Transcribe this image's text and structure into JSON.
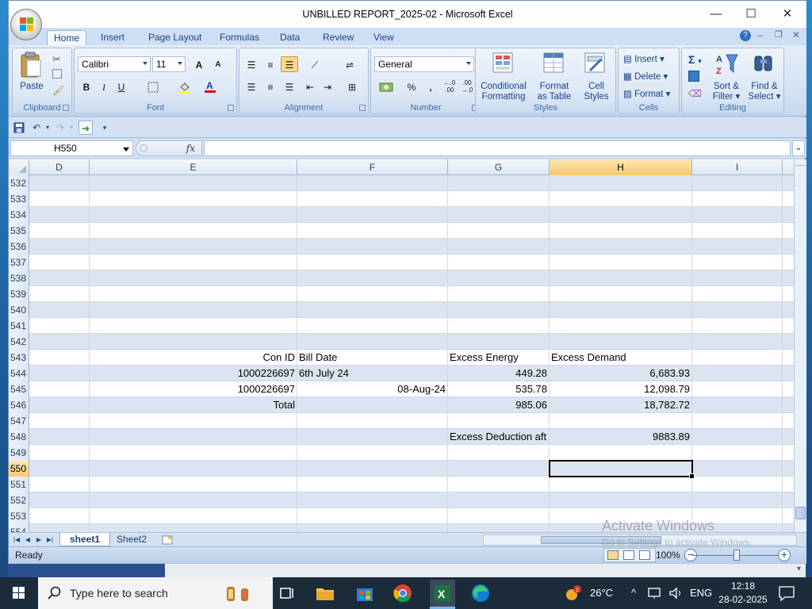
{
  "window": {
    "title": "UNBILLED REPORT_2025-02 - Microsoft Excel",
    "minimize": "—",
    "maximize": "☐",
    "close": "✕"
  },
  "ribbon_tabs": [
    "Home",
    "Insert",
    "Page Layout",
    "Formulas",
    "Data",
    "Review",
    "View"
  ],
  "ribbon": {
    "clipboard": {
      "label": "Clipboard",
      "paste": "Paste"
    },
    "font": {
      "label": "Font",
      "name": "Calibri",
      "size": "11",
      "bold": "B",
      "italic": "I",
      "underline": "U",
      "grow": "A",
      "shrink": "A"
    },
    "alignment": {
      "label": "Alignment"
    },
    "number": {
      "label": "Number",
      "format": "General",
      "percent": "%",
      "comma": ",",
      "inc_dec": ".0 .00",
      "dec_dec": ".00 .0"
    },
    "styles": {
      "label": "Styles",
      "conditional": [
        "Conditional",
        "Formatting"
      ],
      "format_table": [
        "Format",
        "as Table"
      ],
      "cell_styles": [
        "Cell",
        "Styles"
      ]
    },
    "cells": {
      "label": "Cells",
      "insert": "Insert",
      "delete": "Delete",
      "format": "Format"
    },
    "editing": {
      "label": "Editing",
      "sum": "Σ",
      "sort": [
        "Sort &",
        "Filter"
      ],
      "find": [
        "Find &",
        "Select"
      ]
    }
  },
  "formula_bar": {
    "name_box": "H550",
    "fx": "fx",
    "value": ""
  },
  "columns": [
    {
      "id": "D",
      "label": "D"
    },
    {
      "id": "E",
      "label": "E"
    },
    {
      "id": "F",
      "label": "F"
    },
    {
      "id": "G",
      "label": "G"
    },
    {
      "id": "H",
      "label": "H"
    },
    {
      "id": "I",
      "label": "I"
    }
  ],
  "rows": [
    {
      "num": "532",
      "cells": {}
    },
    {
      "num": "533",
      "cells": {}
    },
    {
      "num": "534",
      "cells": {}
    },
    {
      "num": "535",
      "cells": {}
    },
    {
      "num": "536",
      "cells": {}
    },
    {
      "num": "537",
      "cells": {}
    },
    {
      "num": "538",
      "cells": {}
    },
    {
      "num": "539",
      "cells": {}
    },
    {
      "num": "540",
      "cells": {}
    },
    {
      "num": "541",
      "cells": {}
    },
    {
      "num": "542",
      "cells": {}
    },
    {
      "num": "543",
      "cells": {
        "E": "Con ID",
        "F": "Bill Date",
        "G": "Excess Energy",
        "H": "Excess Demand"
      }
    },
    {
      "num": "544",
      "cells": {
        "E": "1000226697",
        "F": "6th July 24",
        "G": "449.28",
        "H": "6,683.93"
      }
    },
    {
      "num": "545",
      "cells": {
        "E": "1000226697",
        "F": "08-Aug-24",
        "G": "535.78",
        "H": "12,098.79"
      }
    },
    {
      "num": "546",
      "cells": {
        "E": "Total",
        "G": "985.06",
        "H": "18,782.72"
      }
    },
    {
      "num": "547",
      "cells": {}
    },
    {
      "num": "548",
      "cells": {
        "G": "Excess Deduction aft",
        "H": "9883.89"
      }
    },
    {
      "num": "549",
      "cells": {}
    },
    {
      "num": "550",
      "cells": {}
    },
    {
      "num": "551",
      "cells": {}
    },
    {
      "num": "552",
      "cells": {}
    },
    {
      "num": "553",
      "cells": {}
    },
    {
      "num": "554",
      "cells": {}
    }
  ],
  "selected": {
    "cell": "H550",
    "column": "H",
    "row": "550"
  },
  "sheet_tabs": [
    "sheet1",
    "Sheet2"
  ],
  "active_sheet": "sheet1",
  "status": {
    "text": "Ready",
    "zoom": "100%"
  },
  "watermark": {
    "line1": "Activate Windows",
    "line2": "Go to Settings to activate Windows."
  },
  "taskbar": {
    "search_placeholder": "Type here to search",
    "weather": "26°C",
    "language": "ENG",
    "time": "12:18",
    "date": "28-02-2025"
  },
  "colors": {
    "selected_header": "#f9c86a",
    "band_row": "#dbe5f1",
    "ribbon_text": "#15428b"
  }
}
